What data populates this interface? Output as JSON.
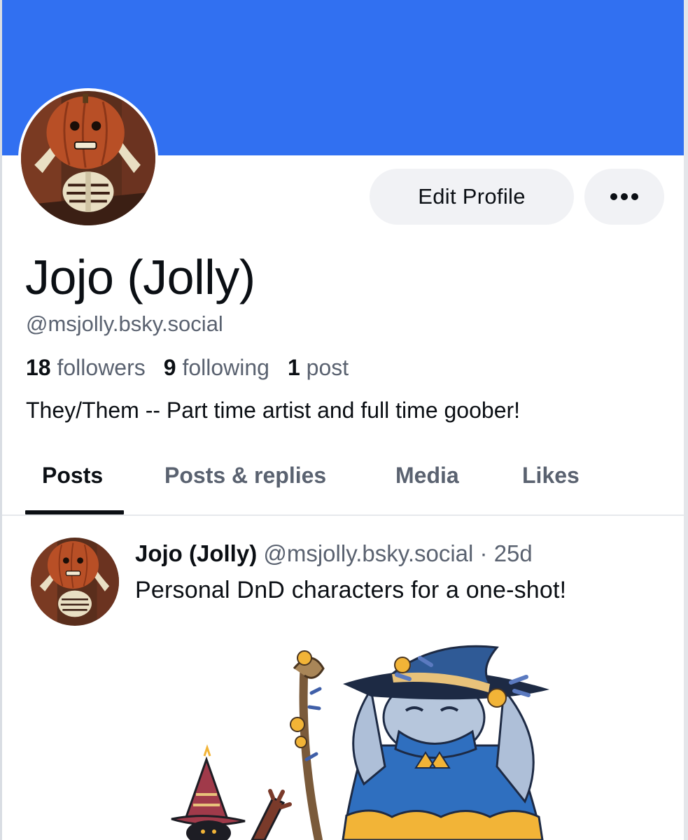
{
  "theme": {
    "banner_color": "#3170f1",
    "text_primary": "#0b0f14",
    "text_secondary": "#5a6270",
    "button_bg": "#f1f2f5"
  },
  "profile": {
    "display_name": "Jojo (Jolly)",
    "handle": "@msjolly.bsky.social",
    "bio": "They/Them -- Part time artist and full time goober!",
    "avatar_icon": "pumpkin-skeleton-avatar",
    "stats": {
      "followers_count": "18",
      "followers_label": "followers",
      "following_count": "9",
      "following_label": "following",
      "posts_count": "1",
      "posts_label": "post"
    }
  },
  "actions": {
    "edit_profile_label": "Edit Profile",
    "more_icon": "ellipsis-icon"
  },
  "tabs": [
    {
      "label": "Posts",
      "active": true
    },
    {
      "label": "Posts & replies",
      "active": false
    },
    {
      "label": "Media",
      "active": false
    },
    {
      "label": "Likes",
      "active": false
    }
  ],
  "feed": {
    "posts": [
      {
        "author_name": "Jojo (Jolly)",
        "author_handle": "@msjolly.bsky.social",
        "separator": "·",
        "age": "25d",
        "text": "Personal DnD characters for a one-shot!",
        "image_subject": "dnd-characters-illustration"
      }
    ]
  }
}
